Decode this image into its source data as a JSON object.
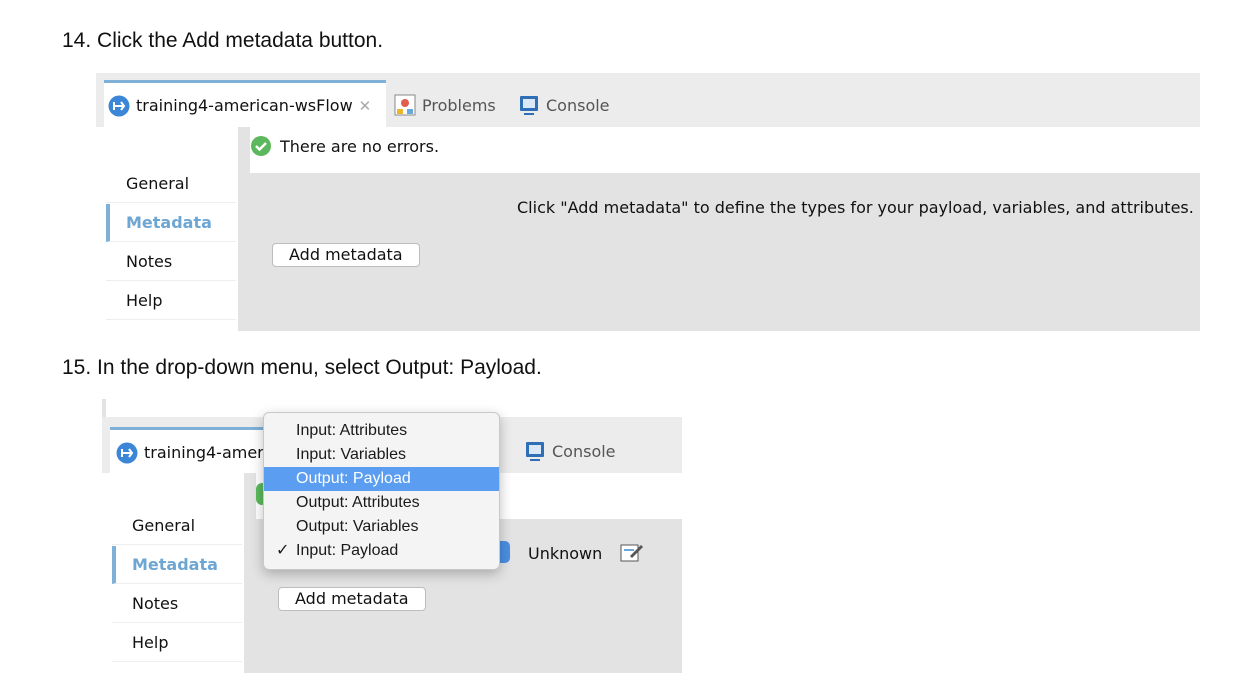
{
  "steps": {
    "step14": "14. Click the Add metadata button.",
    "step15": "15. In the drop-down menu, select Output: Payload."
  },
  "tabs": {
    "flow": "training4-american-wsFlow",
    "flow_truncated": "training4-ameri",
    "problems": "Problems",
    "console": "Console",
    "close_glyph": "✕"
  },
  "status": {
    "no_errors": "There are no errors."
  },
  "sidebar": {
    "general": "General",
    "metadata": "Metadata",
    "notes": "Notes",
    "help": "Help"
  },
  "content": {
    "hint": "Click \"Add metadata\" to define the types for your payload, variables, and attributes.",
    "add_button": "Add metadata",
    "unknown": "Unknown"
  },
  "menu": {
    "items": [
      "Input: Attributes",
      "Input: Variables",
      "Output: Payload",
      "Output: Attributes",
      "Output: Variables",
      "Input: Payload"
    ],
    "selected": "Output: Payload",
    "checked": "Input: Payload",
    "check_glyph": "✓"
  },
  "colors": {
    "accent": "#7fb0d8",
    "selection": "#5b9df0",
    "success": "#5cb85c",
    "flow_icon": "#3b86d6"
  },
  "icons": {
    "flow": "flow-icon",
    "problems": "problems-icon",
    "console": "console-icon",
    "success": "check-circle-icon",
    "edit": "edit-icon",
    "dropdown": "dropdown-arrow-icon"
  }
}
